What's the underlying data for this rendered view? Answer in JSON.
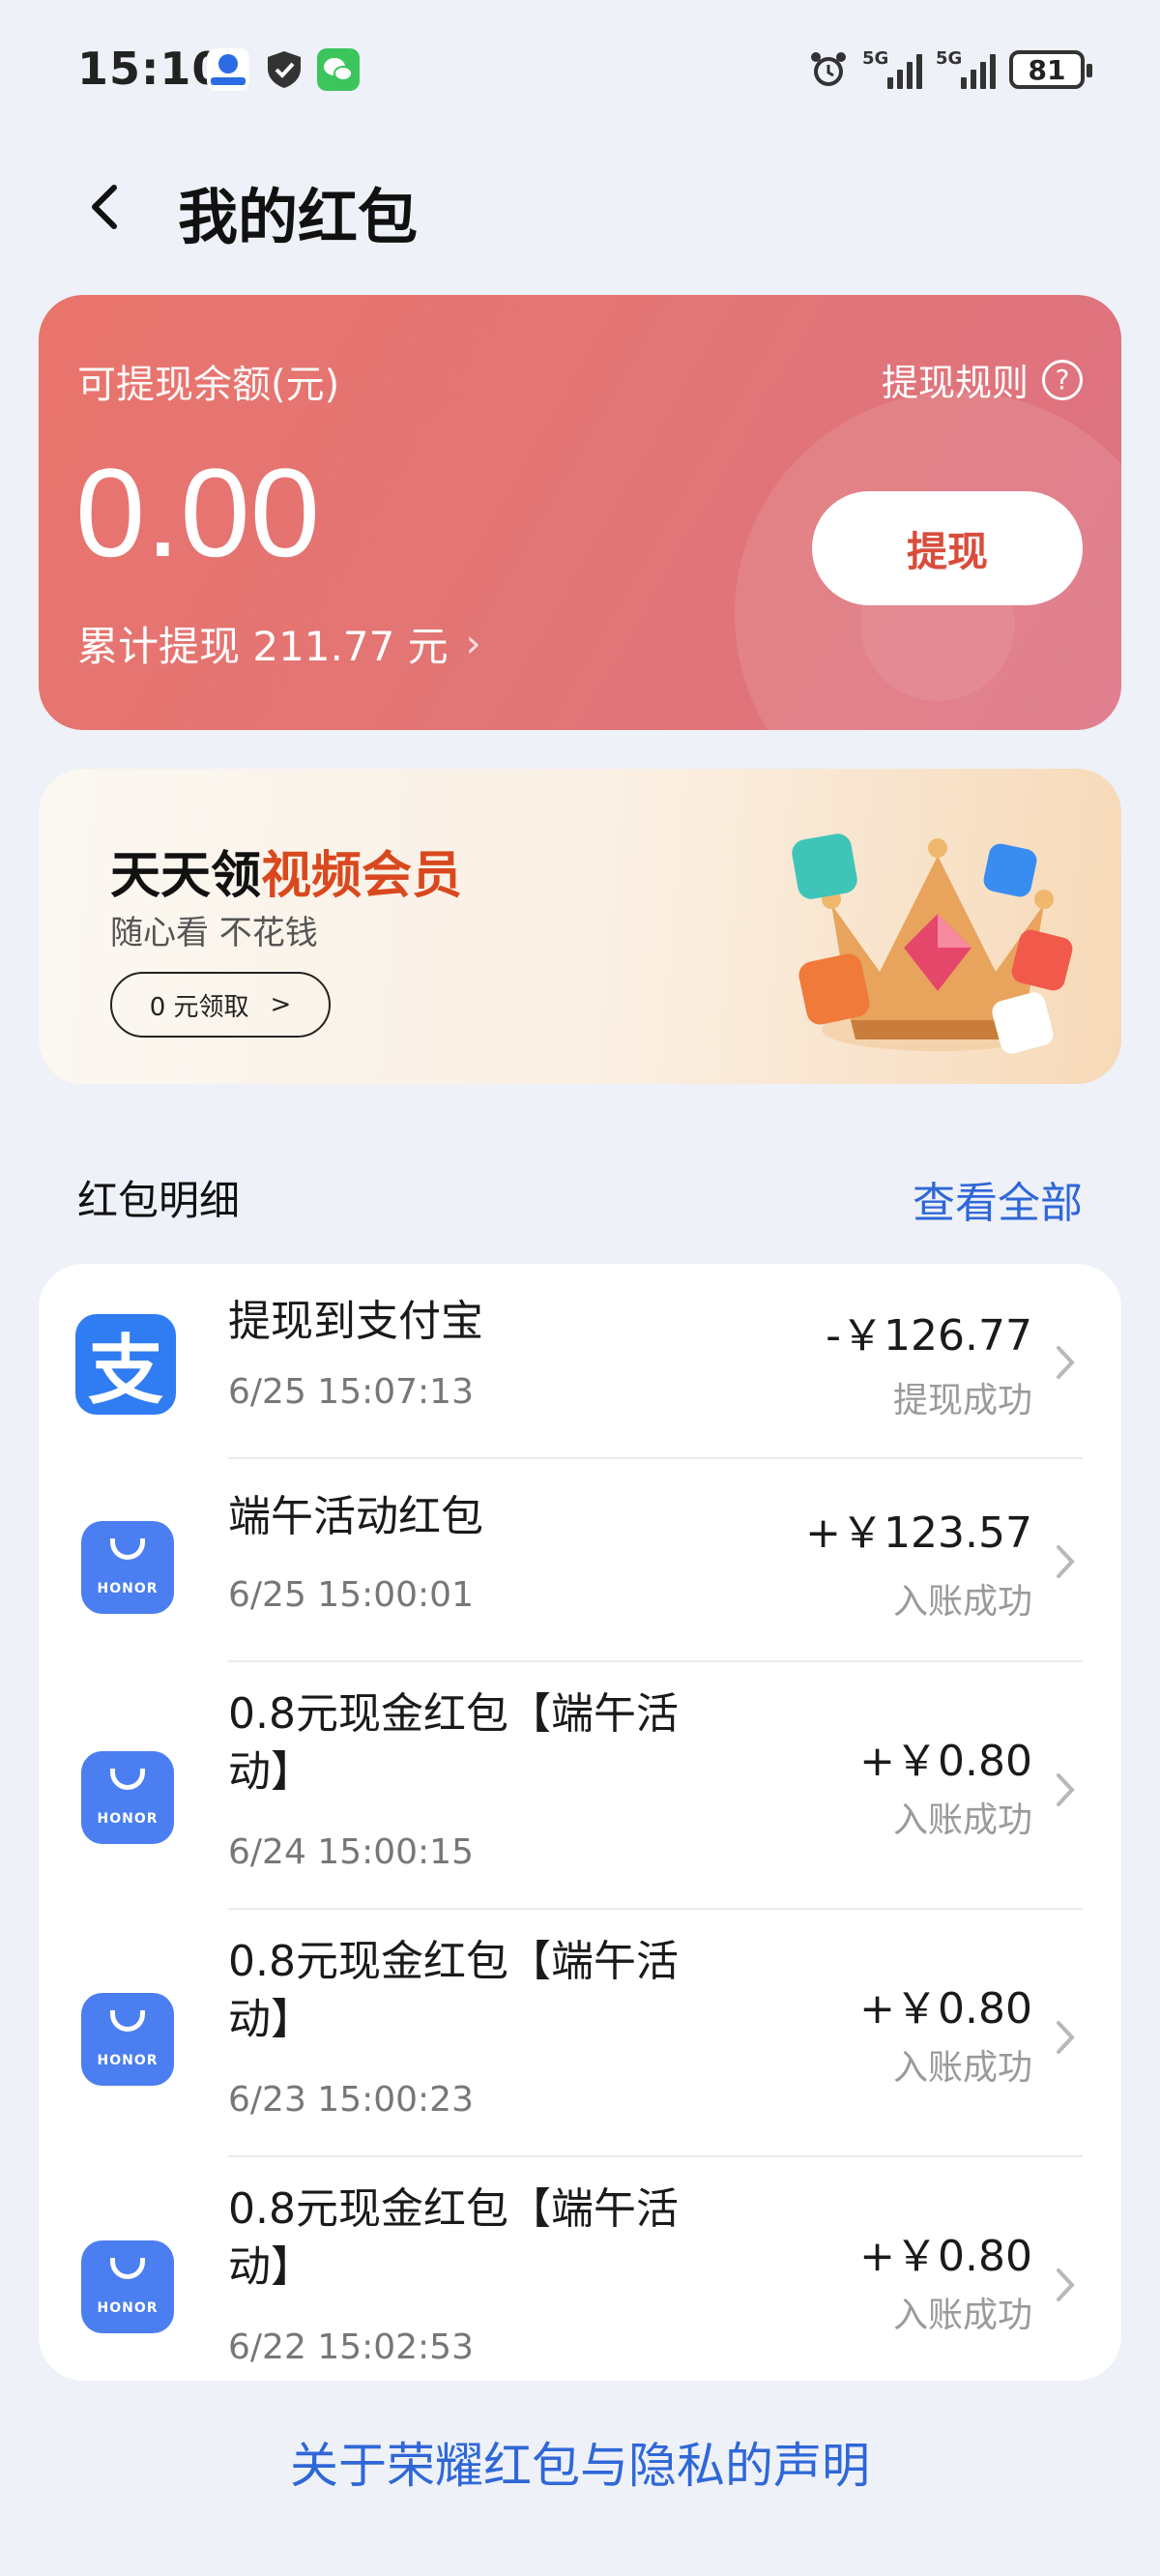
{
  "status_bar": {
    "time": "15:10",
    "network_1": "5G",
    "network_2": "5G",
    "battery": "81"
  },
  "header": {
    "title": "我的红包"
  },
  "balance": {
    "label": "可提现余额(元)",
    "rules_label": "提现规则",
    "amount": "0.00",
    "total_withdrawn": "累计提现 211.77 元",
    "withdraw_button": "提现"
  },
  "promo": {
    "title_part1": "天天领",
    "title_highlight": "视频会员",
    "subtitle": "随心看 不花钱",
    "button_label": "0 元领取",
    "button_arrow": ">"
  },
  "records_section": {
    "title": "红包明细",
    "view_all": "查看全部"
  },
  "records": [
    {
      "icon": "alipay-icon",
      "icon_glyph": "支",
      "title": "提现到支付宝",
      "time": "6/25 15:07:13",
      "amount": "-￥126.77",
      "status": "提现成功"
    },
    {
      "icon": "honor-icon",
      "title": "端午活动红包",
      "time": "6/25 15:00:01",
      "amount": "+￥123.57",
      "status": "入账成功"
    },
    {
      "icon": "honor-icon",
      "title": "0.8元现金红包【端午活动】",
      "time": "6/24 15:00:15",
      "amount": "+￥0.80",
      "status": "入账成功"
    },
    {
      "icon": "honor-icon",
      "title": "0.8元现金红包【端午活动】",
      "time": "6/23 15:00:23",
      "amount": "+￥0.80",
      "status": "入账成功"
    },
    {
      "icon": "honor-icon",
      "title": "0.8元现金红包【端午活动】",
      "time": "6/22 15:02:53",
      "amount": "+￥0.80",
      "status": "入账成功"
    }
  ],
  "honor_brand": "HONOR",
  "footer": {
    "link": "关于荣耀红包与隐私的声明"
  },
  "colors": {
    "accent_blue": "#2f67d8",
    "card_red": "#e17576",
    "highlight_orange": "#d9481e"
  }
}
